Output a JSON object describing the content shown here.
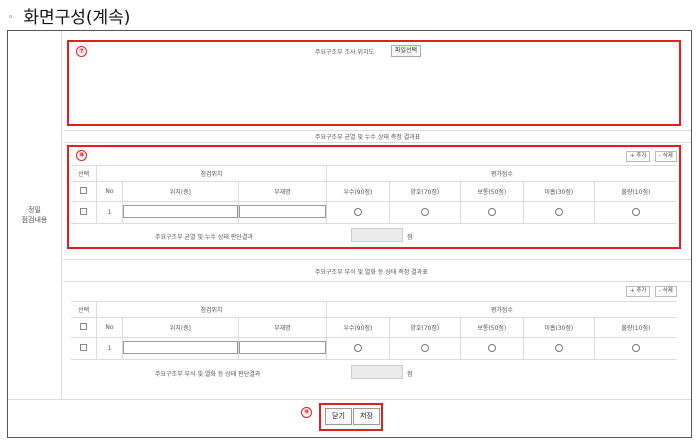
{
  "doc_title": {
    "bullet": "◦",
    "text": "화면구성(계속)"
  },
  "left_label": {
    "line1": "정밀",
    "line2": "점검내용"
  },
  "photo_section": {
    "badge": "⑦",
    "title": "주요구조부 조사 위치도",
    "file_button": "파일선택"
  },
  "section_a": {
    "title": "주요구조부 균열 및 누수 상태 측정 결과표",
    "badge": "⑧",
    "add_button": "+ 추가",
    "delete_button": "- 삭제",
    "header_select": "선택",
    "header_location_group": "점검위치",
    "header_score_group": "평가점수",
    "header_no": "No",
    "header_position": "위치(층)",
    "header_member": "부재명",
    "grades": [
      "우수(90점)",
      "양호(70점)",
      "보통(50점)",
      "미흡(30점)",
      "불량(10점)"
    ],
    "row_no": "1",
    "result_label": "주요구조부 균열 및 누수 상태 판단결과",
    "result_unit": "점"
  },
  "section_b": {
    "title": "주요구조부 부식 및 열화 등 상태 측정 결과표",
    "add_button": "+ 추가",
    "delete_button": "- 삭제",
    "header_select": "선택",
    "header_location_group": "점검위치",
    "header_score_group": "평가점수",
    "header_no": "No",
    "header_position": "위치(층)",
    "header_member": "부재명",
    "grades": [
      "우수(90점)",
      "양호(70점)",
      "보통(50점)",
      "미흡(30점)",
      "불량(10점)"
    ],
    "row_no": "1",
    "result_label": "주요구조부 부식 및 열화 등 상태 판단결과",
    "result_unit": "점"
  },
  "actions": {
    "badge": "⑨",
    "close_button": "닫기",
    "save_button": "저장"
  },
  "colors": {
    "highlight": "#e02020",
    "border": "#dcdcdc"
  }
}
